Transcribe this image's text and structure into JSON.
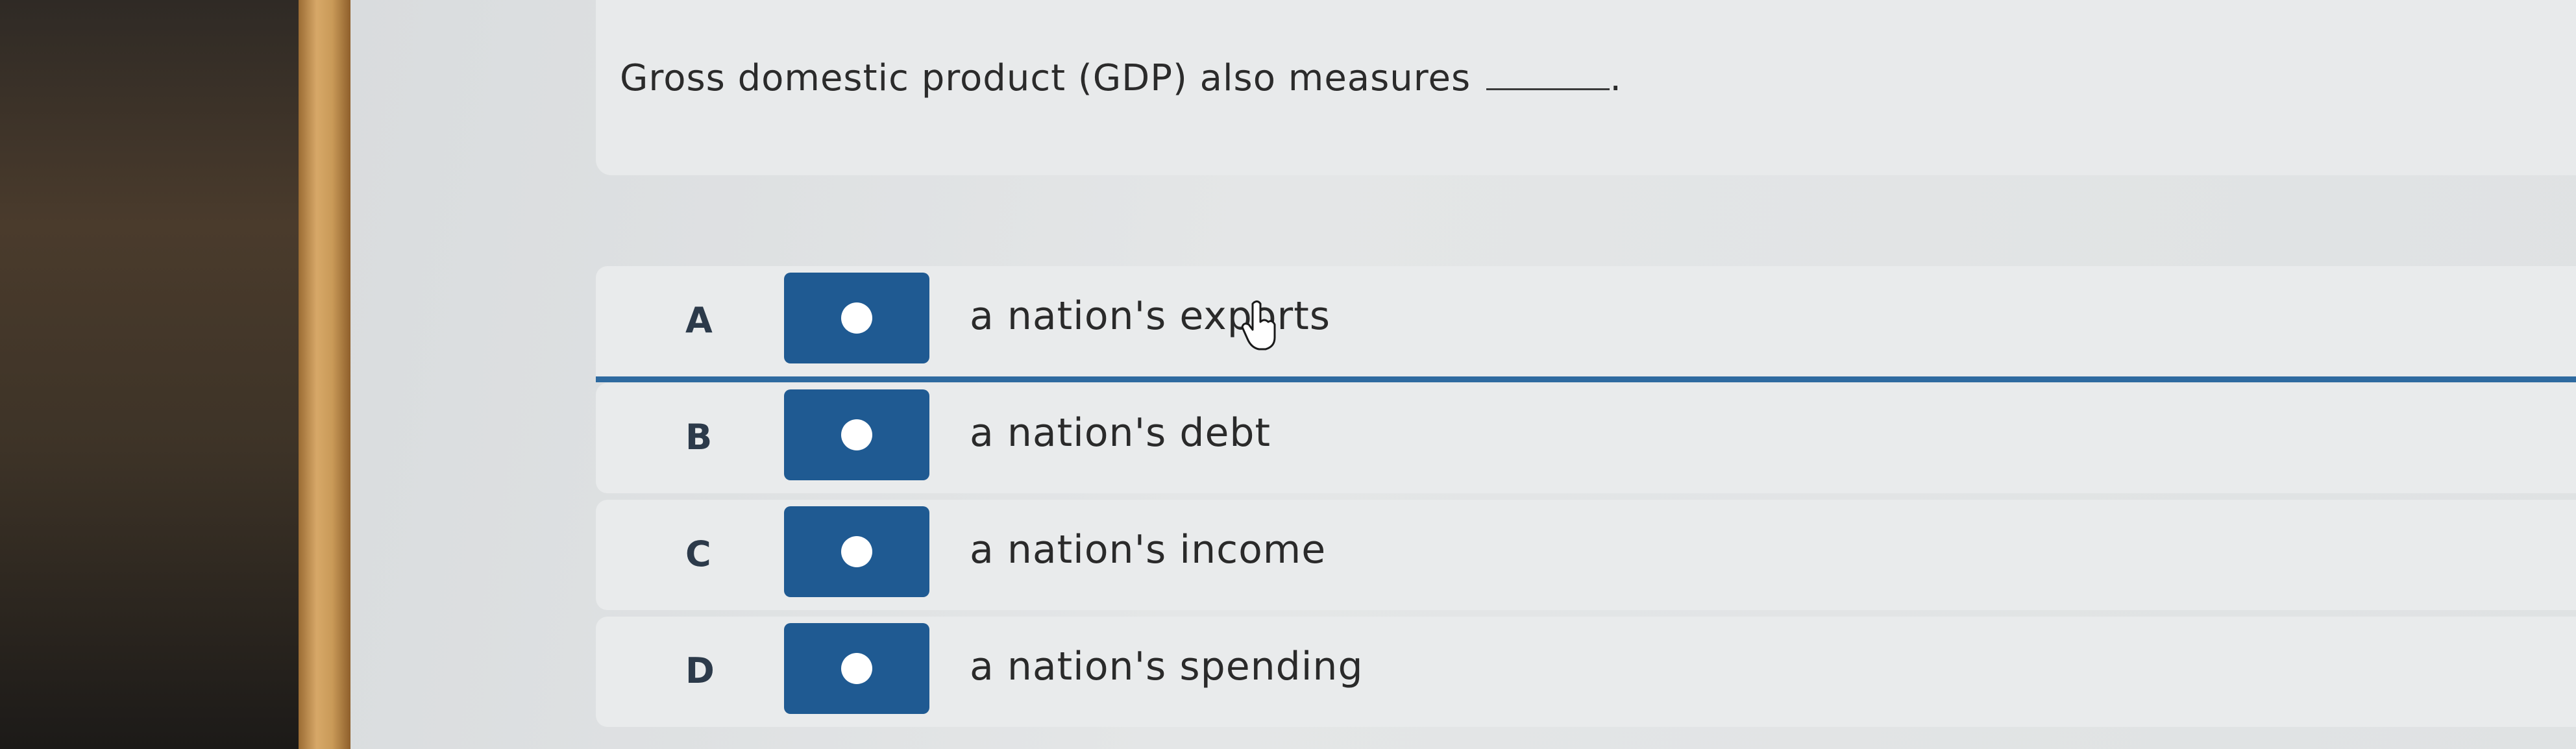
{
  "question": {
    "text": "Gross domestic product (GDP) also measures",
    "suffix": "."
  },
  "options": [
    {
      "letter": "A",
      "text": "a nation's exports",
      "selected": true
    },
    {
      "letter": "B",
      "text": "a nation's debt",
      "selected": false
    },
    {
      "letter": "C",
      "text": "a nation's income",
      "selected": false
    },
    {
      "letter": "D",
      "text": "a nation's spending",
      "selected": false
    }
  ],
  "colors": {
    "radio": "#1f5a92",
    "selected_underline": "#2e6aa0"
  },
  "icons": {
    "cursor": "hand-pointer-icon",
    "radio": "radio-dot-icon"
  }
}
